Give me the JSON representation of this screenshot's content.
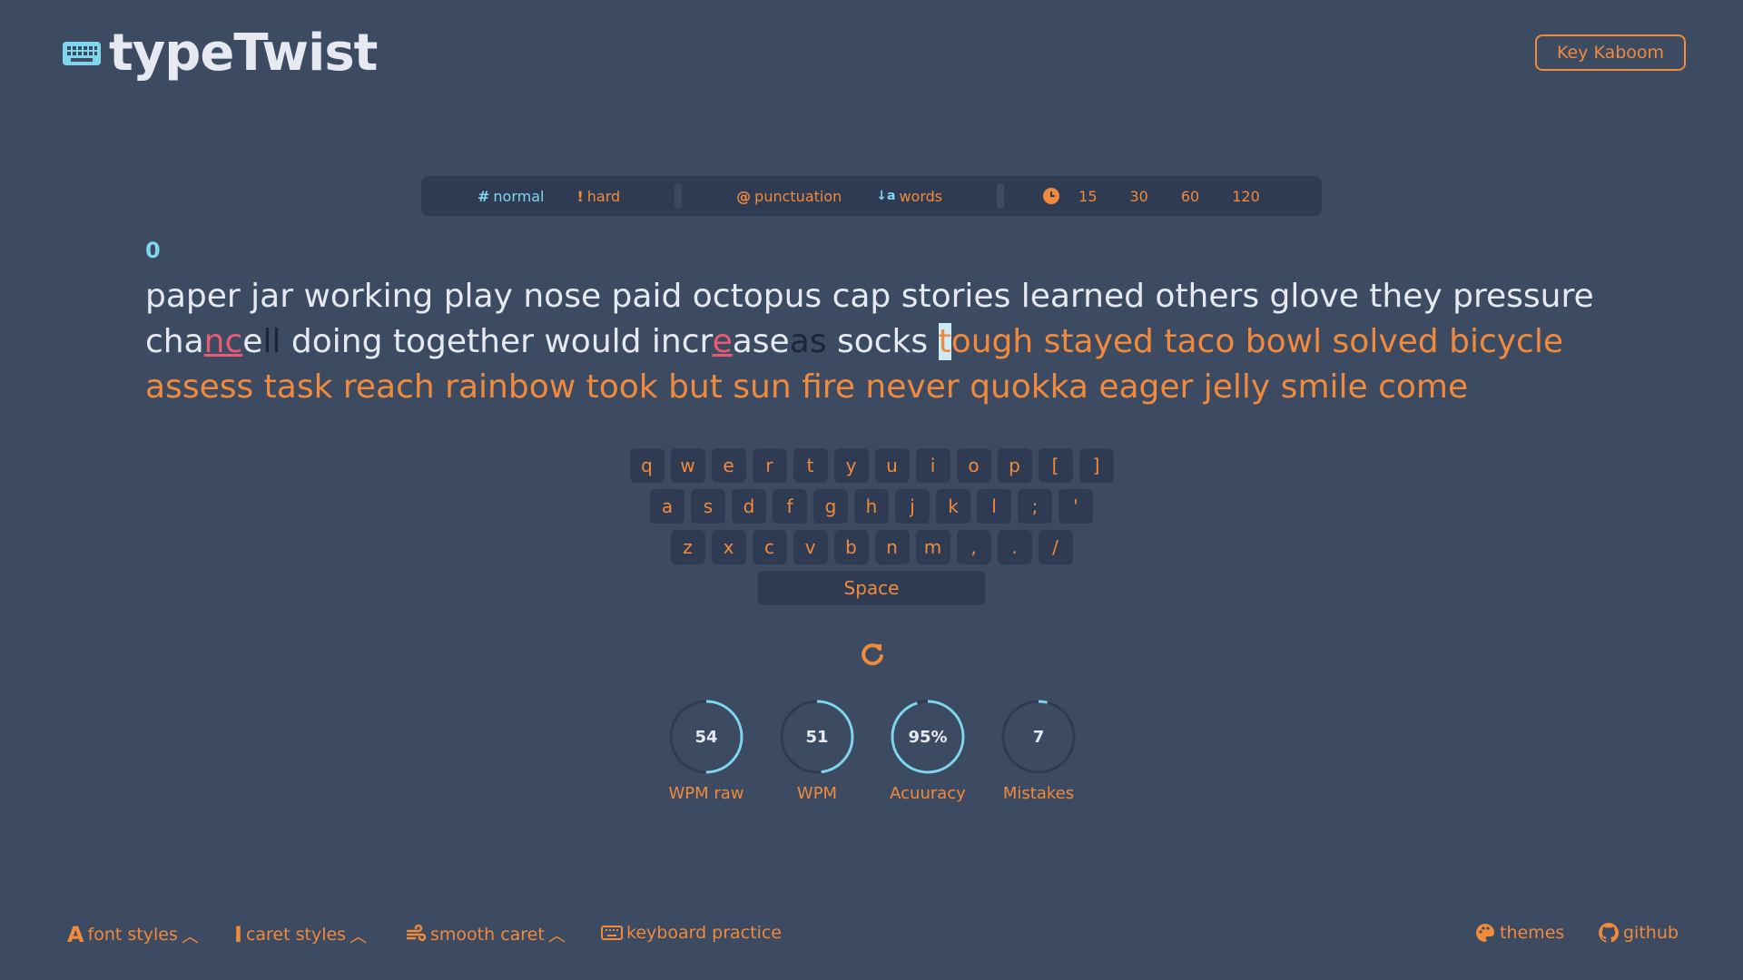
{
  "app": {
    "title": "typeTwist"
  },
  "header": {
    "key_kaboom_label": "Key Kaboom"
  },
  "modebar": {
    "difficulty": [
      {
        "icon": "#",
        "label": "normal",
        "active": true
      },
      {
        "icon": "!",
        "label": "hard",
        "active": false
      }
    ],
    "options": [
      {
        "icon": "@",
        "label": "punctuation",
        "active": false
      },
      {
        "icon": "↓a",
        "label": "words",
        "active": true
      }
    ],
    "times": [
      "15",
      "30",
      "60",
      "120"
    ]
  },
  "test": {
    "counter": "0",
    "line1": "paper jar working play nose paid octopus cap stories learned others glove they pressure",
    "line2": {
      "w1_a": "cha",
      "w1_err": "nc",
      "w1_b": "e",
      "w1_extra": "ll",
      "mid": " doing together would incr",
      "w2_err": "e",
      "w2_b": "ase",
      "w2_extra": "as",
      "w3": " socks ",
      "caret": "t",
      "rest": "ough stayed taco bowl solved bicycle"
    },
    "line3": "assess task reach rainbow took but sun fire never quokka eager jelly smile come"
  },
  "keyboard": {
    "row1": [
      "q",
      "w",
      "e",
      "r",
      "t",
      "y",
      "u",
      "i",
      "o",
      "p",
      "[",
      "]"
    ],
    "row2": [
      "a",
      "s",
      "d",
      "f",
      "g",
      "h",
      "j",
      "k",
      "l",
      ";",
      "'"
    ],
    "row3": [
      "z",
      "x",
      "c",
      "v",
      "b",
      "n",
      "m",
      ",",
      ".",
      "/"
    ],
    "space_label": "Space"
  },
  "stats": [
    {
      "value": "54",
      "label": "WPM raw",
      "fraction": 0.5
    },
    {
      "value": "51",
      "label": "WPM",
      "fraction": 0.48
    },
    {
      "value": "95%",
      "label": "Acuuracy",
      "fraction": 0.95
    },
    {
      "value": "7",
      "label": "Mistakes",
      "fraction": 0.04
    }
  ],
  "footer": {
    "font_styles": "font styles",
    "caret_styles": "caret styles",
    "smooth_caret": "smooth caret",
    "keyboard_practice": "keyboard practice",
    "themes": "themes",
    "github": "github"
  },
  "colors": {
    "background": "#3c4a62",
    "panel": "#2f3b52",
    "accent": "#f08a3c",
    "highlight": "#7fd6ee",
    "error": "#e85b73",
    "text": "#e6e9ef"
  }
}
